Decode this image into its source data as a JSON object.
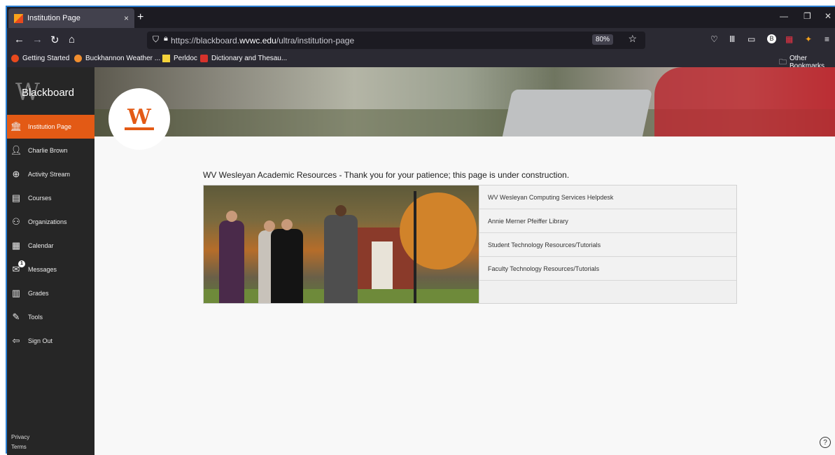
{
  "browser": {
    "tab_title": "Institution Page",
    "tab_close": "×",
    "new_tab": "+",
    "url_prefix": "https://blackboard.",
    "url_domain": "wvwc.edu",
    "url_path": "/ultra/institution-page",
    "zoom": "80%",
    "bookmarks": [
      {
        "label": "Getting Started",
        "color": "#e8491d"
      },
      {
        "label": "Buckhannon Weather ...",
        "color": "#f18e2f"
      },
      {
        "label": "Perldoc",
        "color": "#f5d33b"
      },
      {
        "label": "Dictionary and Thesau...",
        "color": "#d6322b"
      }
    ],
    "other_bookmarks": "Other Bookmarks"
  },
  "sidebar": {
    "logo": "Blackboard",
    "items": [
      {
        "label": "Institution Page",
        "icon": "institution-icon"
      },
      {
        "label": "Charlie Brown",
        "icon": "user-icon"
      },
      {
        "label": "Activity Stream",
        "icon": "globe-icon"
      },
      {
        "label": "Courses",
        "icon": "courses-icon"
      },
      {
        "label": "Organizations",
        "icon": "organizations-icon"
      },
      {
        "label": "Calendar",
        "icon": "calendar-icon"
      },
      {
        "label": "Messages",
        "icon": "messages-icon",
        "badge": "1"
      },
      {
        "label": "Grades",
        "icon": "grades-icon"
      },
      {
        "label": "Tools",
        "icon": "tools-icon"
      },
      {
        "label": "Sign Out",
        "icon": "sign-out-icon"
      }
    ],
    "footer": {
      "privacy": "Privacy",
      "terms": "Terms"
    }
  },
  "main": {
    "heading": "WV Wesleyan Academic Resources - Thank you for your patience; this page is under construction.",
    "links": [
      "WV Wesleyan Computing Services Helpdesk",
      "Annie Merner Pfeiffer Library",
      "Student Technology Resources/Tutorials",
      "Faculty Technology Resources/Tutorials"
    ]
  },
  "colors": {
    "accent": "#e35a15",
    "sidebar_bg": "#262626"
  }
}
